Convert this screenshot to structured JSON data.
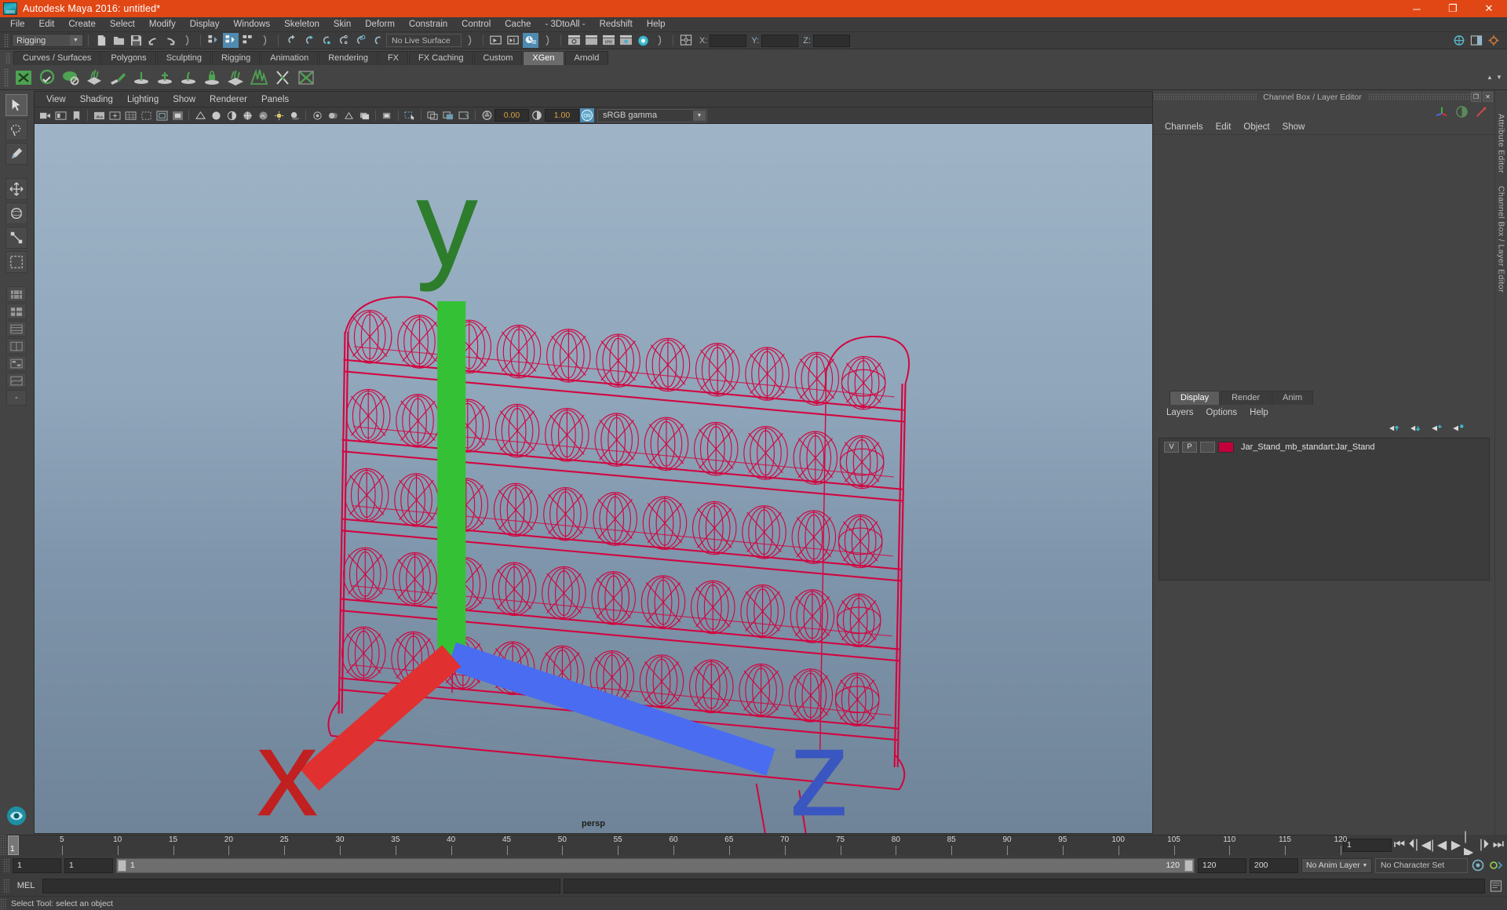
{
  "window": {
    "title": "Autodesk Maya 2016: untitled*",
    "logo_icon": "maya-logo-icon",
    "minimize": "─",
    "maximize": "❐",
    "close": "✕"
  },
  "menubar": {
    "items": [
      "File",
      "Edit",
      "Create",
      "Select",
      "Modify",
      "Display",
      "Windows",
      "Skeleton",
      "Skin",
      "Deform",
      "Constrain",
      "Control",
      "Cache",
      "- 3DtoAll -",
      "Redshift",
      "Help"
    ]
  },
  "statusbar": {
    "mode": "Rigging",
    "live_surface": "No Live Surface",
    "coords": {
      "x_label": "X:",
      "y_label": "Y:",
      "z_label": "Z:",
      "x_value": "",
      "y_value": "",
      "z_value": ""
    }
  },
  "shelf": {
    "tabs": [
      "Curves / Surfaces",
      "Polygons",
      "Sculpting",
      "Rigging",
      "Animation",
      "Rendering",
      "FX",
      "FX Caching",
      "Custom",
      "XGen",
      "Arnold"
    ],
    "selected_tab": "XGen",
    "icons": [
      "xgen-description-icon",
      "xgen-collection-icon",
      "xgen-preview-icon",
      "xgen-groom-icon",
      "xgen-guides-icon",
      "xgen-density-brush-icon",
      "xgen-length-brush-icon",
      "xgen-width-brush-icon",
      "xgen-part-brush-icon",
      "xgen-clump-icon",
      "xgen-noise-icon",
      "xgen-cut-icon",
      "xgen-region-icon"
    ]
  },
  "toolbox": {
    "tools": [
      "select-tool",
      "lasso-select-tool",
      "paint-select-tool",
      "move-tool",
      "rotate-tool",
      "scale-tool",
      "soft-select-tool",
      "last-tool"
    ],
    "layouts": [
      "layout-single-icon",
      "layout-two-pane-icon",
      "layout-four-pane-icon",
      "layout-persp-outliner-icon",
      "layout-hypergraph-icon",
      "layout-persp-graph-icon",
      "layout-more-icon"
    ],
    "bottom_icon": "maya-orb-icon"
  },
  "viewport": {
    "panel_menus": [
      "View",
      "Shading",
      "Lighting",
      "Show",
      "Renderer",
      "Panels"
    ],
    "camera_label": "persp",
    "toolbar": {
      "exposure_value": "0.00",
      "gamma_value": "1.00",
      "color_mgmt_toggle": "ON",
      "color_profile": "sRGB gamma",
      "icons": [
        "select-camera-icon",
        "bookmark-icon",
        "image-plane-icon",
        "grid-toggle-icon",
        "film-gate-icon",
        "resolution-gate-icon",
        "gate-mask-icon",
        "xray-icon",
        "wireframe-on-shaded-icon",
        "smooth-shade-icon",
        "flat-shade-icon",
        "textured-icon",
        "lighting-icon",
        "shadows-icon",
        "screen-space-ao-icon",
        "motion-blur-icon",
        "multisample-icon",
        "depth-peel-icon",
        "isolate-select-icon",
        "grid-icon",
        "frame-all-icon",
        "exposure-icon",
        "contrast-icon"
      ]
    },
    "model": {
      "name": "Jar_Stand wireframe",
      "wire_color": "#d5003c",
      "shelves": 5,
      "jars_per_shelf": 11
    },
    "axis_gizmo": {
      "x": "x",
      "y": "y",
      "z": "z"
    }
  },
  "right_dock": {
    "panel_title": "Channel Box / Layer Editor",
    "undock_icon": "undock-icon",
    "close_icon": "close-icon",
    "quick_icons": [
      "move-manip-icon",
      "channel-box-icon",
      "attribute-editor-icon"
    ],
    "channel_menu": [
      "Channels",
      "Edit",
      "Object",
      "Show"
    ],
    "attribute_editor_label": "Attribute Editor",
    "channel_box_label": "Channel Box / Layer Editor"
  },
  "layer_editor": {
    "tabs": [
      "Display",
      "Render",
      "Anim"
    ],
    "selected_tab": "Display",
    "menus": [
      "Layers",
      "Options",
      "Help"
    ],
    "buttons": [
      "move-layer-up-icon",
      "move-layer-down-icon",
      "new-layer-icon",
      "new-layer-from-selection-icon"
    ],
    "layers": [
      {
        "visibility": "V",
        "playback": "P",
        "shading": "",
        "color": "#c4003b",
        "name": "Jar_Stand_mb_standart:Jar_Stand"
      }
    ]
  },
  "timeline": {
    "current_frame": "1",
    "ticks": [
      5,
      10,
      15,
      20,
      25,
      30,
      35,
      40,
      45,
      50,
      55,
      60,
      65,
      70,
      75,
      80,
      85,
      90,
      95,
      100,
      105,
      110,
      115,
      120
    ],
    "start": 1,
    "end": 120,
    "frame_field": "1",
    "transport": [
      "go-to-start-icon",
      "step-back-key-icon",
      "step-back-frame-icon",
      "play-backwards-icon",
      "play-forwards-icon",
      "step-forward-frame-icon",
      "step-forward-key-icon",
      "go-to-end-icon"
    ]
  },
  "range": {
    "anim_start": "1",
    "range_start": "1",
    "slider_start_label": "1",
    "slider_end_label": "120",
    "range_end": "120",
    "anim_end": "200",
    "anim_layer": "No Anim Layer",
    "character_set": "No Character Set",
    "auto_key_icon": "auto-keyframe-icon",
    "pref_icon": "animation-preferences-icon"
  },
  "command_line": {
    "language": "MEL",
    "input_value": "",
    "output_value": "",
    "script_editor_icon": "script-editor-icon"
  },
  "help_line": {
    "message": "Select Tool: select an object"
  },
  "colors": {
    "title_bar": "#e14715",
    "accent_blue": "#4f8ab0",
    "wire_red": "#d5003c",
    "panel_bg": "#444444"
  }
}
